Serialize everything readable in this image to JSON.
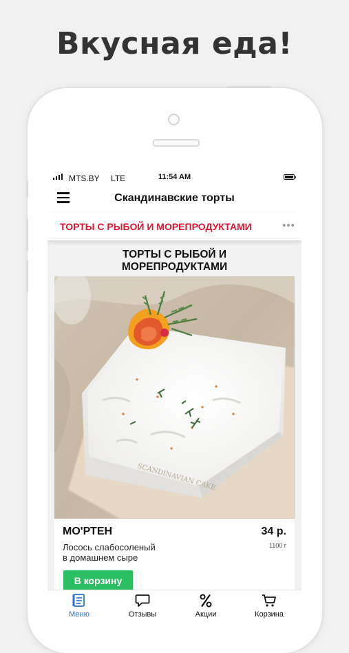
{
  "headline": "Вкусная еда!",
  "status_bar": {
    "carrier": "MTS.BY",
    "network": "LTE",
    "time": "11:54 AM"
  },
  "app_bar": {
    "title": "Скандинавские торты"
  },
  "category_tabs": {
    "active": "ТОРТЫ С РЫБОЙ И МОРЕПРОДУКТАМИ",
    "more_icon": "ellipsis-icon"
  },
  "section": {
    "title_line1": "ТОРТЫ С РЫБОЙ И",
    "title_line2": "МОРЕПРОДУКТАМИ"
  },
  "product": {
    "name": "МО'РТЕН",
    "price": "34 р.",
    "weight": "1100 г",
    "description_line1": "Лосось слабосоленый",
    "description_line2": "в домашнем сыре",
    "add_button": "В корзину",
    "image": "square white cake with salmon rose, lemon and rosemary"
  },
  "bottom_nav": {
    "items": [
      {
        "label": "Меню",
        "icon": "menu-book-icon",
        "active": true
      },
      {
        "label": "Отзывы",
        "icon": "chat-bubble-icon",
        "active": false
      },
      {
        "label": "Акции",
        "icon": "percent-icon",
        "active": false
      },
      {
        "label": "Корзина",
        "icon": "cart-icon",
        "active": false
      }
    ]
  },
  "colors": {
    "accent_red": "#e4132f",
    "button_green": "#2bbd62",
    "nav_active_blue": "#2f6fd6",
    "page_background": "#f1f1f1"
  }
}
